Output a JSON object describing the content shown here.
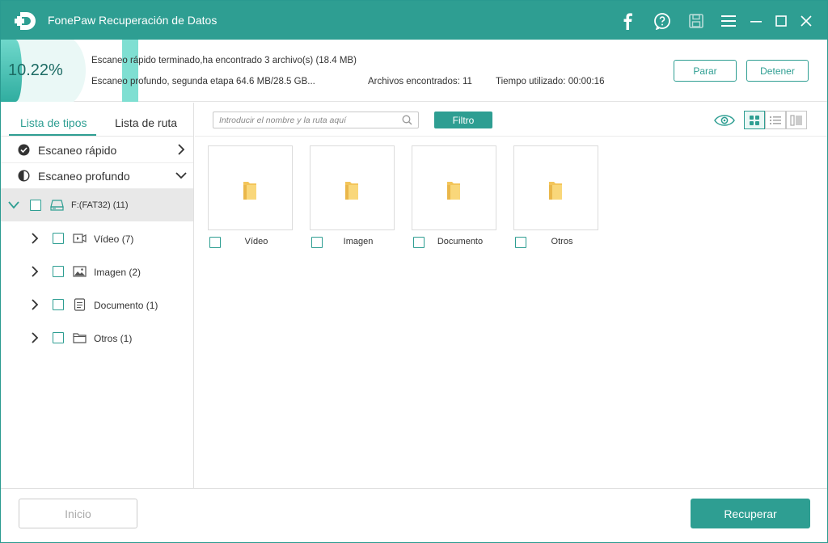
{
  "app": {
    "title": "FonePaw Recuperación de Datos",
    "accent": "#2e9e92"
  },
  "titlebar": {
    "icons": [
      "facebook-icon",
      "help-icon",
      "save-icon",
      "menu-icon",
      "minimize-icon",
      "maximize-icon",
      "close-icon"
    ]
  },
  "scan": {
    "progress_text": "10.22%",
    "progress_value": 10.22,
    "line1": "Escaneo rápido terminado,ha encontrado 3 archivo(s) (18.4 MB)",
    "line2": "Escaneo profundo, segunda etapa 64.6 MB/28.5 GB...",
    "found": "Archivos encontrados: 11",
    "time": "Tiempo utilizado: 00:00:16",
    "pause_label": "Parar",
    "stop_label": "Detener"
  },
  "sidebar": {
    "tabs": [
      {
        "label": "Lista de tipos",
        "active": true
      },
      {
        "label": "Lista de ruta",
        "active": false
      }
    ],
    "quick_scan": "Escaneo rápido",
    "deep_scan": "Escaneo profundo",
    "drive": "F:(FAT32) (11)",
    "items": [
      {
        "label": "Vídeo (7)",
        "icon": "video-icon"
      },
      {
        "label": "Imagen (2)",
        "icon": "image-icon"
      },
      {
        "label": "Documento (1)",
        "icon": "document-icon"
      },
      {
        "label": "Otros (1)",
        "icon": "folder-icon"
      }
    ]
  },
  "toolbar": {
    "search_placeholder": "Introducir el nombre y la ruta aquí",
    "filter_label": "Filtro",
    "views": [
      "grid-view-icon",
      "list-view-icon",
      "detail-view-icon"
    ],
    "active_view": "grid-view-icon"
  },
  "cards": [
    {
      "label": "Vídeo"
    },
    {
      "label": "Imagen"
    },
    {
      "label": "Documento"
    },
    {
      "label": "Otros"
    }
  ],
  "footer": {
    "back_label": "Inicio",
    "recover_label": "Recuperar"
  }
}
